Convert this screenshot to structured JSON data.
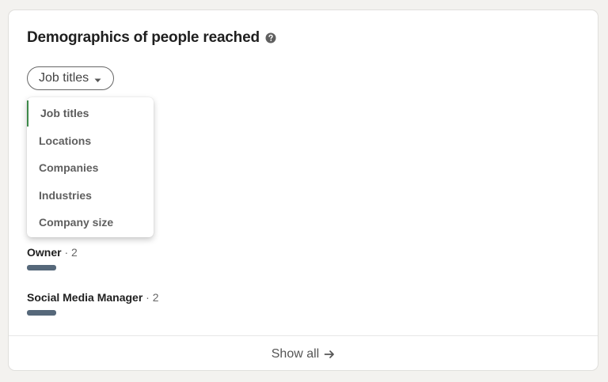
{
  "card": {
    "title": "Demographics of people reached",
    "help_icon": "help-circle-icon"
  },
  "filter": {
    "selected_label": "Job titles",
    "caret_icon": "caret-down-icon"
  },
  "dropdown": {
    "items": [
      {
        "label": "Job titles",
        "selected": true
      },
      {
        "label": "Locations",
        "selected": false
      },
      {
        "label": "Companies",
        "selected": false
      },
      {
        "label": "Industries",
        "selected": false
      },
      {
        "label": "Company size",
        "selected": false
      }
    ],
    "selected_accent": "#3d8a4a"
  },
  "stats": [
    {
      "name": "Owner",
      "separator": "·",
      "count": "2"
    },
    {
      "name": "Social Media Manager",
      "separator": "·",
      "count": "2"
    }
  ],
  "footer": {
    "label": "Show all",
    "arrow_icon": "arrow-right-icon"
  },
  "colors": {
    "bar": "#56687a",
    "background": "#f3f2ef",
    "card": "#ffffff"
  }
}
